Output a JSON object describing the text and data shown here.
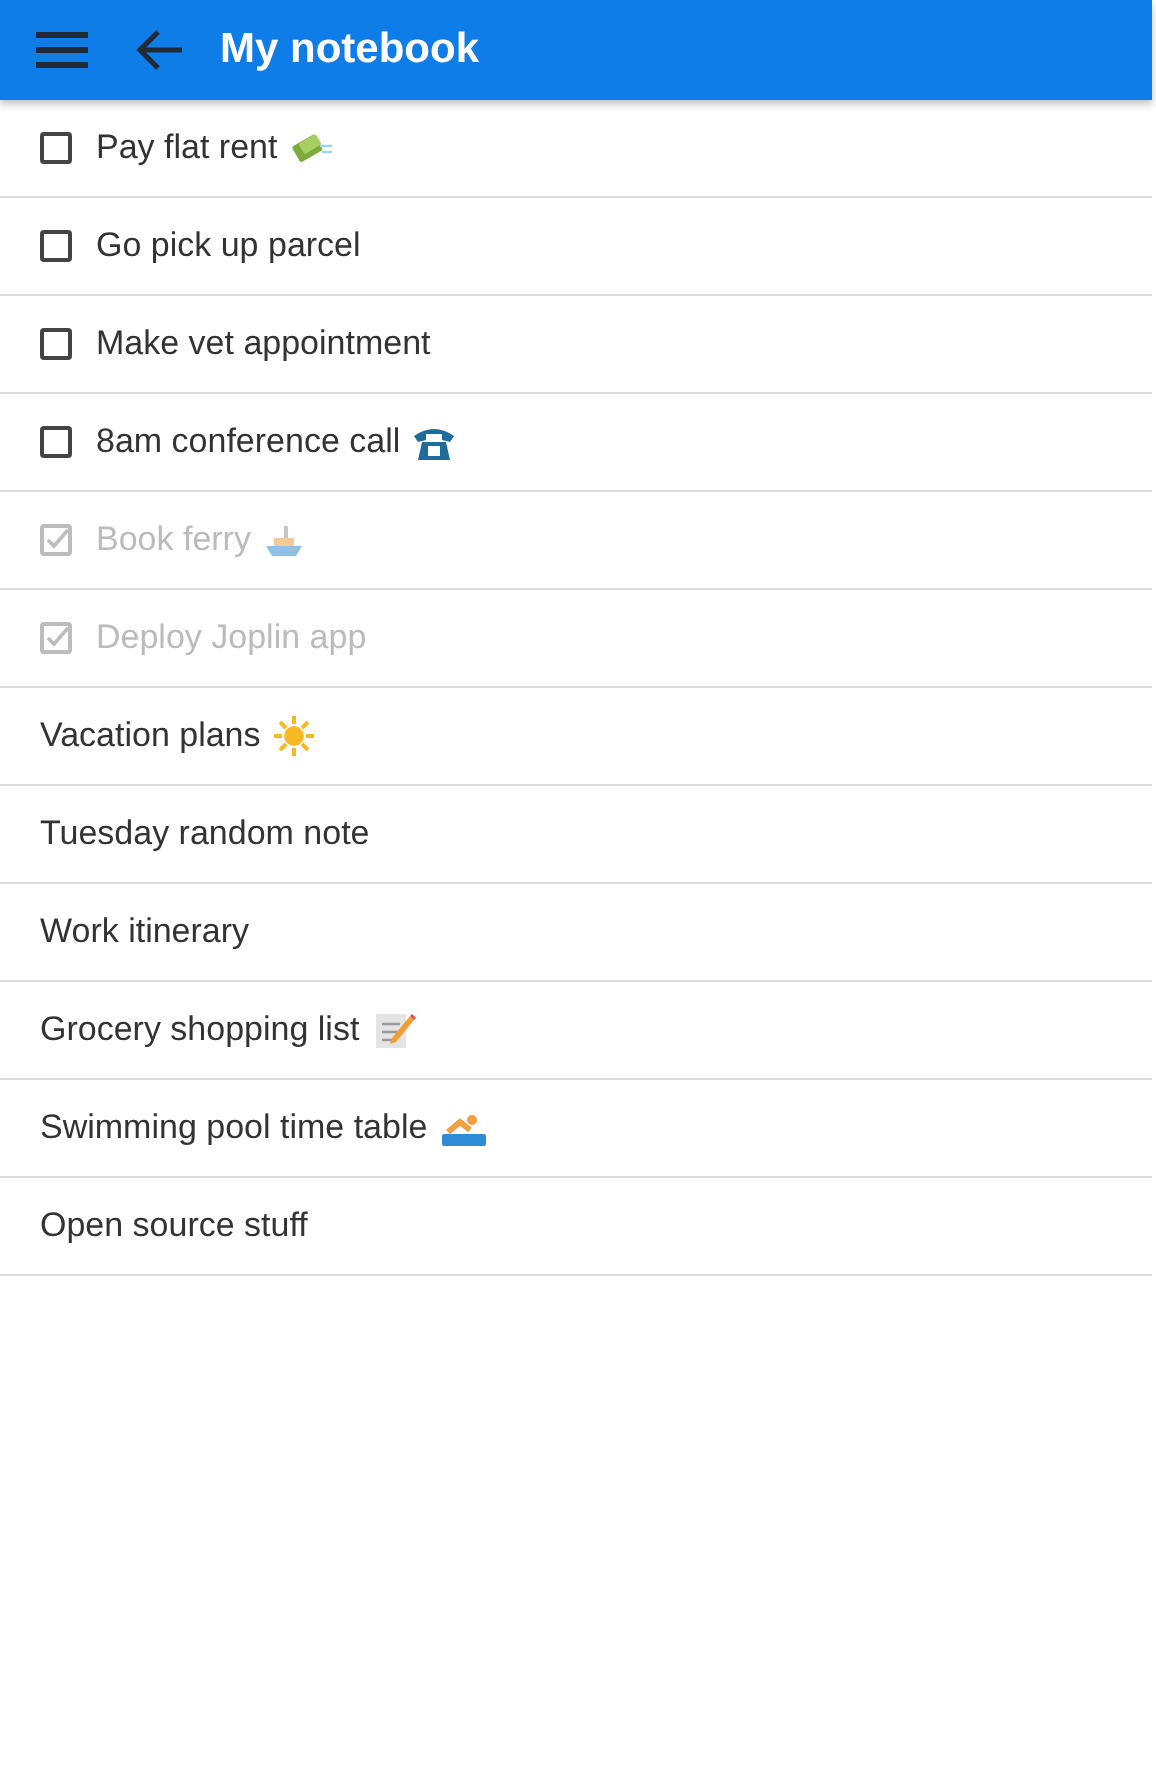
{
  "header": {
    "title": "My notebook"
  },
  "notes": [
    {
      "kind": "todo",
      "title": "Pay flat rent",
      "checked": false
    },
    {
      "kind": "todo",
      "title": "Go pick up parcel",
      "checked": false
    },
    {
      "kind": "todo",
      "title": "Make vet appointment",
      "checked": false
    },
    {
      "kind": "todo",
      "title": "8am conference call",
      "checked": false
    },
    {
      "kind": "todo",
      "title": "Book ferry",
      "checked": true
    },
    {
      "kind": "todo",
      "title": "Deploy Joplin app",
      "checked": true
    },
    {
      "kind": "note",
      "title": "Vacation plans"
    },
    {
      "kind": "note",
      "title": "Tuesday random note"
    },
    {
      "kind": "note",
      "title": "Work itinerary"
    },
    {
      "kind": "note",
      "title": "Grocery shopping list"
    },
    {
      "kind": "note",
      "title": "Swimming pool time table"
    },
    {
      "kind": "note",
      "title": "Open source stuff"
    }
  ]
}
